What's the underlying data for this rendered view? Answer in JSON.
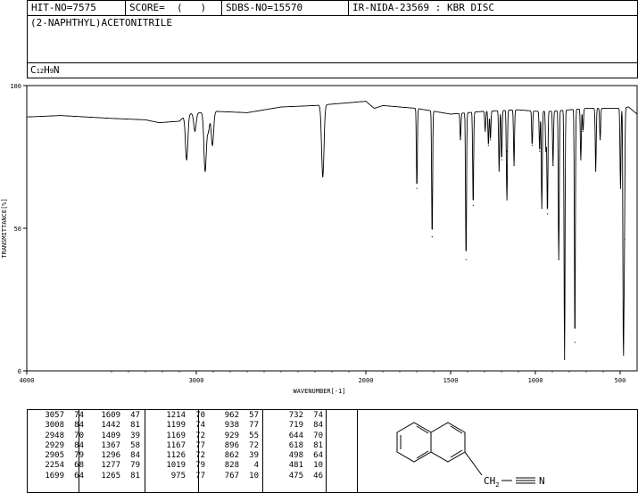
{
  "header": {
    "hit_no": "HIT-NO=7575",
    "score": "SCORE=  (   )",
    "sdbs_no": "SDBS-NO=15570",
    "ir_method": "IR-NIDA-23569 : KBR DISC"
  },
  "compound": {
    "name": "(2-NAPHTHYL)ACETONITRILE",
    "formula_c": "C",
    "formula_c_sub": "12",
    "formula_h": "H",
    "formula_h_sub": "9",
    "formula_n": "N"
  },
  "structure": {
    "group_ch2": "CH",
    "group_ch2_sub": "2",
    "group_n": "N"
  },
  "chart_data": {
    "type": "line",
    "xlabel": "WAVENUMBER[-1]",
    "ylabel": "TRANSMITTANCE[%]",
    "xlim": [
      4000,
      400
    ],
    "ylim": [
      0,
      100
    ],
    "xticks": [
      4000,
      3000,
      2000,
      1500,
      1000,
      500
    ],
    "yticks": [
      0,
      50,
      100
    ],
    "baseline": [
      [
        4000,
        89
      ],
      [
        3800,
        89.5
      ],
      [
        3500,
        88.5
      ],
      [
        3300,
        88
      ],
      [
        3220,
        87
      ],
      [
        3100,
        87.5
      ],
      [
        3057,
        90
      ],
      [
        2900,
        91
      ],
      [
        2700,
        90.5
      ],
      [
        2500,
        92.5
      ],
      [
        2300,
        93
      ],
      [
        2100,
        94
      ],
      [
        2000,
        94.5
      ],
      [
        1950,
        92
      ],
      [
        1900,
        93
      ],
      [
        1800,
        92.5
      ],
      [
        1700,
        92
      ],
      [
        1600,
        91
      ],
      [
        1500,
        90
      ],
      [
        1300,
        91
      ],
      [
        1100,
        91.5
      ],
      [
        1000,
        91
      ],
      [
        900,
        91
      ],
      [
        700,
        92
      ],
      [
        600,
        92
      ],
      [
        500,
        92
      ],
      [
        450,
        92.5
      ],
      [
        400,
        90
      ]
    ],
    "peaks": [
      {
        "wavenumber": 3057,
        "transmittance": 74
      },
      {
        "wavenumber": 3008,
        "transmittance": 84
      },
      {
        "wavenumber": 2948,
        "transmittance": 70
      },
      {
        "wavenumber": 2929,
        "transmittance": 84
      },
      {
        "wavenumber": 2905,
        "transmittance": 79
      },
      {
        "wavenumber": 2254,
        "transmittance": 68
      },
      {
        "wavenumber": 1699,
        "transmittance": 64
      },
      {
        "wavenumber": 1609,
        "transmittance": 47
      },
      {
        "wavenumber": 1442,
        "transmittance": 81
      },
      {
        "wavenumber": 1409,
        "transmittance": 39
      },
      {
        "wavenumber": 1367,
        "transmittance": 58
      },
      {
        "wavenumber": 1296,
        "transmittance": 84
      },
      {
        "wavenumber": 1277,
        "transmittance": 79
      },
      {
        "wavenumber": 1265,
        "transmittance": 81
      },
      {
        "wavenumber": 1214,
        "transmittance": 70
      },
      {
        "wavenumber": 1199,
        "transmittance": 74
      },
      {
        "wavenumber": 1169,
        "transmittance": 72
      },
      {
        "wavenumber": 1167,
        "transmittance": 77
      },
      {
        "wavenumber": 1126,
        "transmittance": 72
      },
      {
        "wavenumber": 1019,
        "transmittance": 79
      },
      {
        "wavenumber": 975,
        "transmittance": 77
      },
      {
        "wavenumber": 962,
        "transmittance": 57
      },
      {
        "wavenumber": 938,
        "transmittance": 77
      },
      {
        "wavenumber": 929,
        "transmittance": 55
      },
      {
        "wavenumber": 896,
        "transmittance": 72
      },
      {
        "wavenumber": 862,
        "transmittance": 39
      },
      {
        "wavenumber": 828,
        "transmittance": 4
      },
      {
        "wavenumber": 767,
        "transmittance": 10
      },
      {
        "wavenumber": 732,
        "transmittance": 74
      },
      {
        "wavenumber": 719,
        "transmittance": 84
      },
      {
        "wavenumber": 644,
        "transmittance": 70
      },
      {
        "wavenumber": 618,
        "transmittance": 81
      },
      {
        "wavenumber": 498,
        "transmittance": 64
      },
      {
        "wavenumber": 481,
        "transmittance": 10
      },
      {
        "wavenumber": 475,
        "transmittance": 46
      }
    ]
  },
  "peak_table_columns": [
    [
      [
        "3057",
        "74"
      ],
      [
        "3008",
        "84"
      ],
      [
        "2948",
        "70"
      ],
      [
        "2929",
        "84"
      ],
      [
        "2905",
        "79"
      ],
      [
        "2254",
        "68"
      ],
      [
        "1699",
        "64"
      ]
    ],
    [
      [
        "1609",
        "47"
      ],
      [
        "1442",
        "81"
      ],
      [
        "1409",
        "39"
      ],
      [
        "1367",
        "58"
      ],
      [
        "1296",
        "84"
      ],
      [
        "1277",
        "79"
      ],
      [
        "1265",
        "81"
      ]
    ],
    [
      [
        "1214",
        "70"
      ],
      [
        "1199",
        "74"
      ],
      [
        "1169",
        "72"
      ],
      [
        "1167",
        "77"
      ],
      [
        "1126",
        "72"
      ],
      [
        "1019",
        "79"
      ],
      [
        "975",
        "77"
      ]
    ],
    [
      [
        "962",
        "57"
      ],
      [
        "938",
        "77"
      ],
      [
        "929",
        "55"
      ],
      [
        "896",
        "72"
      ],
      [
        "862",
        "39"
      ],
      [
        "828",
        "4"
      ],
      [
        "767",
        "10"
      ]
    ],
    [
      [
        "732",
        "74"
      ],
      [
        "719",
        "84"
      ],
      [
        "644",
        "70"
      ],
      [
        "618",
        "81"
      ],
      [
        "498",
        "64"
      ],
      [
        "481",
        "10"
      ],
      [
        "475",
        "46"
      ]
    ]
  ]
}
